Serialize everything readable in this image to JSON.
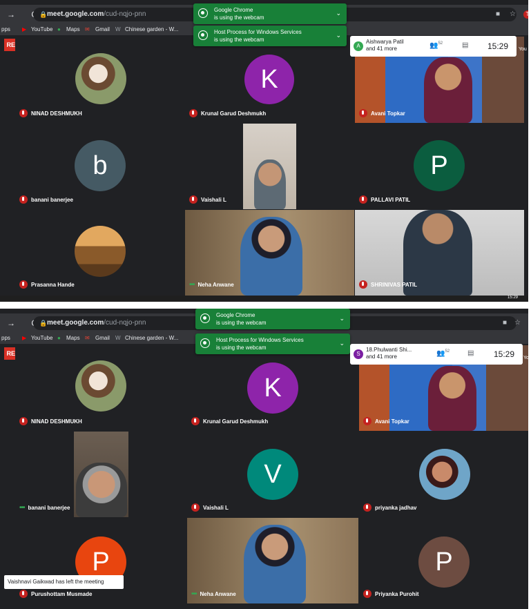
{
  "browser": {
    "url_host": "meet.google.com",
    "url_path": "/cud-nqjo-pnn",
    "bookmarks": [
      "pps",
      "YouTube",
      "Maps",
      "Gmail",
      "Chinese garden - W..."
    ],
    "profile_initial": "T"
  },
  "notifications": {
    "chrome_title": "Google Chrome",
    "chrome_text": "is using the webcam",
    "host_title": "Host Process for Windows Services",
    "host_text": "is using the webcam"
  },
  "rec_label": "REC",
  "you_label": "You",
  "screenshot1": {
    "presenter_name": "Aishwarya Patil",
    "presenter_initial": "A",
    "more_label": "and 41 more",
    "people_count": "52",
    "clock": "15:29",
    "taskbar_time": "15:29",
    "tiles": [
      {
        "name": "NINAD DESHMUKH"
      },
      {
        "name": "Krunal Garud Deshmukh",
        "initial": "K"
      },
      {
        "name": "Avani Topkar"
      },
      {
        "name": "banani banerjee",
        "initial": "b"
      },
      {
        "name": "Vaishali L"
      },
      {
        "name": "PALLAVI PATIL",
        "initial": "P"
      },
      {
        "name": "Prasanna Hande"
      },
      {
        "name": "Neha Anwane"
      },
      {
        "name": "SHRINIVAS PATIL"
      }
    ]
  },
  "screenshot2": {
    "presenter_name": "18.Phulwanti Shi...",
    "presenter_initial": "S",
    "more_label": "and 41 more",
    "people_count": "52",
    "clock": "15:29",
    "toast": "Vaishnavi Gaikwad has left the meeting",
    "tiles": [
      {
        "name": "NINAD DESHMUKH"
      },
      {
        "name": "Krunal Garud Deshmukh",
        "initial": "K"
      },
      {
        "name": "Avani Topkar"
      },
      {
        "name": "banani banerjee"
      },
      {
        "name": "Vaishali L",
        "initial": "V"
      },
      {
        "name": "priyanka jadhav"
      },
      {
        "name": "Purushottam Musmade",
        "initial": "P"
      },
      {
        "name": "Neha Anwane"
      },
      {
        "name": "Priyanka Purohit",
        "initial": "P"
      }
    ]
  },
  "colors": {
    "k_avatar": "#8e24aa",
    "b_avatar": "#455a64",
    "p_green_avatar": "#0b5d3f",
    "v_avatar": "#00897b",
    "p_orange_avatar": "#e8450f",
    "p_brown_avatar": "#6d4c41",
    "notification_green": "#188038",
    "mute_red": "#c5221f"
  }
}
